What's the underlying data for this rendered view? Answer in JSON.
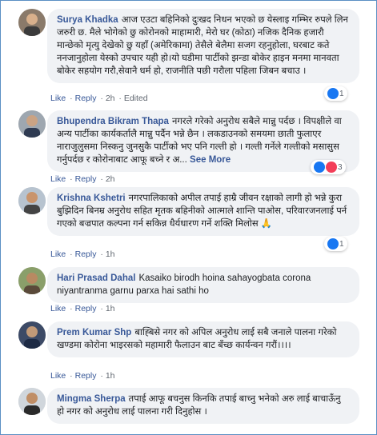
{
  "comments": [
    {
      "author": "Surya Khadka",
      "text": "आज एउटा बहिनिको दुःखद निधन भएको छ येस्लाइ गम्भिर रुपले लिन जरुरी छ. मैले भोगेको छु कोरोनको माहामारी, मेरो घर (कोठा) नजिक दैनिक हजारौ मान्छेको मृत्यु देखेको छु यहाँ (अमेरिकामा) तेसैले बेलैमा सजग रहनुहोला, घरबाट कते ननजानुहोला येस्को उपचार यही हो।यो घडीमा पार्टीको झन्डा बोकेर हाइन मनमा मानवता बोकेर सहयोग गरौ,सेवानै धर्म हो, राजनीति पछी गरौला पहिला जिबन बचाउ ।",
      "like": "Like",
      "reply": "Reply",
      "time": "2h",
      "extra": "Edited",
      "reaction_count": "1",
      "reactions": [
        "like-icon"
      ]
    },
    {
      "author": "Bhupendra Bikram Thapa",
      "text": "नगरले गरेको अनुरोध सबैले मान्नु पर्दछ । विपक्षीले वा अन्य पार्टीका कार्यकर्तालै मान्नु पर्दैन भन्ने छैन । लकडाउनको समयमा छाती फुलाएर नाराजुलुसमा निस्कनु जुनसुकै पार्टीको भए पनि गल्ती हो । गल्ती गर्नेले गल्तीको मसासुस गर्नुपर्दछ र कोरोनाबाट आफू बच्ने र अ...",
      "see_more": "See More",
      "like": "Like",
      "reply": "Reply",
      "time": "2h",
      "reaction_count": "3",
      "reactions": [
        "like-icon",
        "love-icon"
      ]
    },
    {
      "author": "Krishna Kshetri",
      "text": "नगरपालिकाको अपील तपाई हाम्रै जीवन रक्षाको लागी हो भन्ने कुरा बुझिदिन बिनम्र अनुरोध सहित मृतक बहिनीको आत्माले शान्ति पाओस, परिवारजनलाई पर्न गएको बज्रपात कल्पना गर्न सकिन्न धैर्यधारण गर्ने शक्ति मिलोस 🙏",
      "like": "Like",
      "reply": "Reply",
      "time": "1h",
      "reaction_count": "1",
      "reactions": [
        "like-icon"
      ]
    },
    {
      "author": "Hari Prasad Dahal",
      "text": "Kasaiko birodh hoina sahayogbata corona niyantranma garnu parxa hai sathi ho",
      "like": "Like",
      "reply": "Reply",
      "time": "1h"
    },
    {
      "author": "Prem Kumar Shp",
      "text": "बाह्बिसे नगर को अपिल अनुरोध लाई सबै जनाले पालना गरेको खण्डमा कोरोना भाइरसको महामारी फैलाउन बाट बँच्छ कार्यन्वन गरौं।।।।",
      "like": "Like",
      "reply": "Reply",
      "time": "1h"
    },
    {
      "author": "Mingma Sherpa",
      "text": "तपाई आफू बचनुस किनकि तपाई बाच्नु भनेको अरु लाई बाचाऊँनु हो नगर को अनुरोध लाई पालना गरी दिनुहोस ।",
      "like": "Like",
      "reply": "Reply",
      "time": "1h"
    }
  ],
  "colors": {
    "author": "#385898",
    "bubble": "#f0f2f5",
    "like": "#1877f2",
    "love": "#f33e58",
    "frame": "#5a8fc4"
  }
}
